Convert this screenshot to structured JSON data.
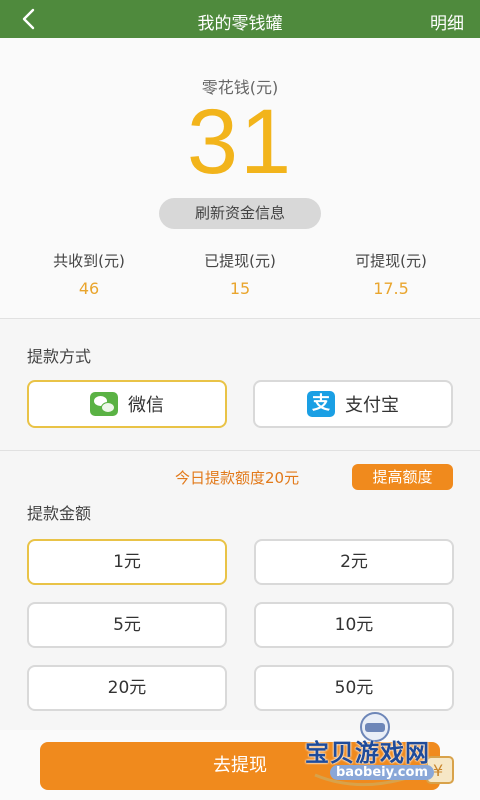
{
  "header": {
    "title": "我的零钱罐",
    "right_link": "明细"
  },
  "pocket": {
    "label": "零花钱(元)",
    "amount": "31",
    "refresh_label": "刷新资金信息"
  },
  "stats": [
    {
      "label": "共收到(元)",
      "value": "46"
    },
    {
      "label": "已提现(元)",
      "value": "15"
    },
    {
      "label": "可提现(元)",
      "value": "17.5"
    }
  ],
  "payment": {
    "section_label": "提款方式",
    "options": [
      {
        "label": "微信",
        "icon": "wechat-icon",
        "selected": true
      },
      {
        "label": "支付宝",
        "icon": "alipay-icon",
        "selected": false
      }
    ]
  },
  "quota": {
    "text": "今日提款额度20元",
    "button_label": "提高额度"
  },
  "amount": {
    "section_label": "提款金额",
    "options": [
      "1元",
      "2元",
      "5元",
      "10元",
      "20元",
      "50元"
    ],
    "selected": "1元"
  },
  "submit_label": "去提现",
  "watermark": {
    "brand": "宝贝游戏网",
    "site": "baobeiy.com"
  },
  "colors": {
    "header_bg": "#4f8a3d",
    "accent_orange": "#f08a1d",
    "amount_gold": "#f2b41b",
    "selected_border": "#e9c347"
  }
}
